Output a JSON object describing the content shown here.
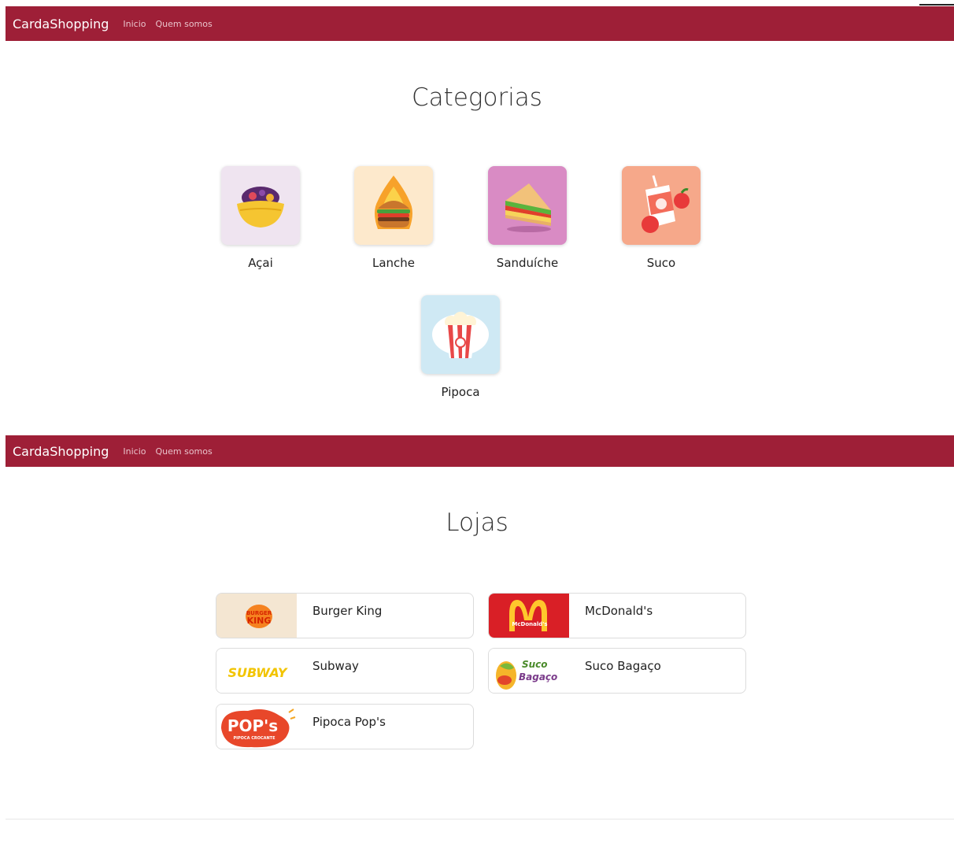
{
  "nav": {
    "brand": "CardaShopping",
    "links": [
      "Inicio",
      "Quem somos"
    ]
  },
  "categorias": {
    "title": "Categorias",
    "items": [
      {
        "label": "Açai",
        "icon": "acai-bowl-icon",
        "bg": "#efe4f0"
      },
      {
        "label": "Lanche",
        "icon": "burger-icon",
        "bg": "#fde9cc"
      },
      {
        "label": "Sanduíche",
        "icon": "sandwich-icon",
        "bg": "#d98bc4"
      },
      {
        "label": "Suco",
        "icon": "juice-icon",
        "bg": "#f6a88a"
      },
      {
        "label": "Pipoca",
        "icon": "popcorn-icon",
        "bg": "#cfe9f4"
      }
    ]
  },
  "lojas": {
    "title": "Lojas",
    "stores": [
      {
        "name": "Burger King",
        "logo_text": [
          "BURGER",
          "KING"
        ],
        "logo_bg": "#f4e6d2"
      },
      {
        "name": "McDonald's",
        "logo_text": [
          "McDonald's"
        ],
        "logo_bg": "#d91f26"
      },
      {
        "name": "Subway",
        "logo_text": [
          "SUBWAY"
        ],
        "logo_bg": "#ffffff"
      },
      {
        "name": "Suco Bagaço",
        "logo_text": [
          "Suco",
          "Bagaço"
        ],
        "logo_bg": "#ffffff"
      },
      {
        "name": "Pipoca Pop's",
        "logo_text": [
          "POP's",
          "PIPOCA CROCANTE"
        ],
        "logo_bg": "#ffffff"
      }
    ]
  }
}
